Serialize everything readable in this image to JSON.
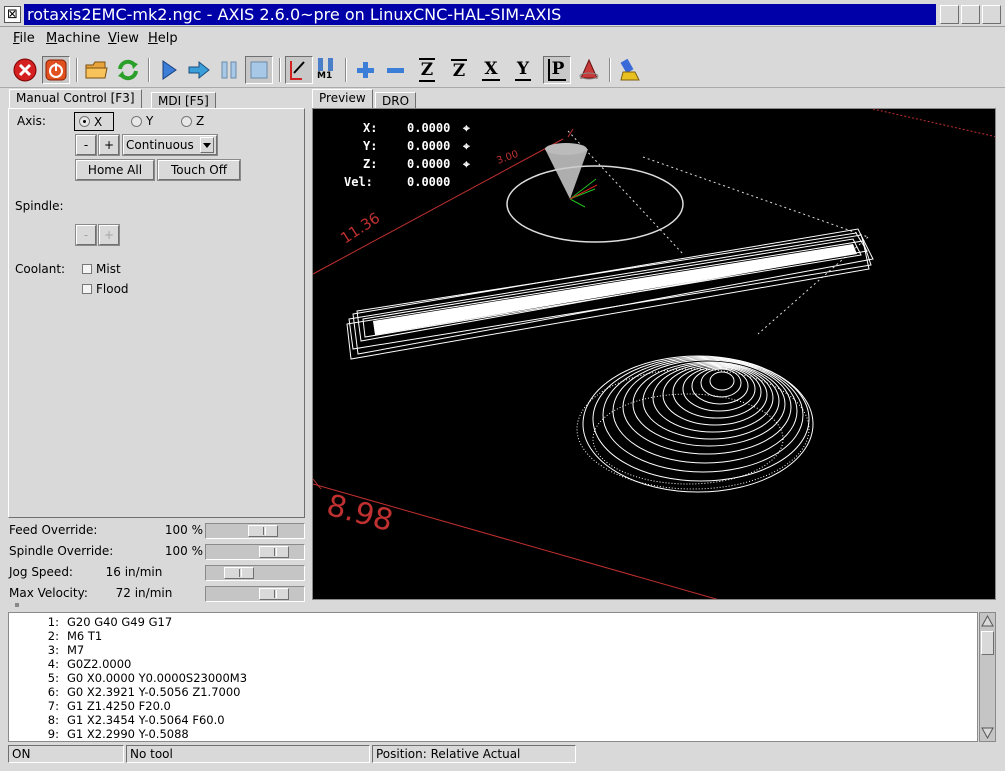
{
  "window": {
    "title": "rotaxis2EMC-mk2.ngc - AXIS 2.6.0~pre on LinuxCNC-HAL-SIM-AXIS"
  },
  "menu": [
    {
      "label": "File",
      "underline": "F",
      "rest": "ile"
    },
    {
      "label": "Machine",
      "underline": "M",
      "rest": "achine"
    },
    {
      "label": "View",
      "underline": "V",
      "rest": "iew"
    },
    {
      "label": "Help",
      "underline": "H",
      "rest": "elp"
    }
  ],
  "toolbar": {
    "icons": [
      "estop-icon",
      "machine-power-icon",
      "open-file-icon",
      "reload-icon",
      "run-icon",
      "step-icon",
      "pause-icon",
      "stop-icon",
      "block-delete-icon",
      "optional-stop-icon",
      "zoom-in-icon",
      "zoom-out-icon",
      "view-z-icon",
      "view-z2-icon",
      "view-x-icon",
      "view-y-icon",
      "view-p-icon",
      "rotate-view-icon",
      "clear-backplot-icon"
    ],
    "optional_stop_label": "M1",
    "view_letters": {
      "z": "Z",
      "z2": "Z",
      "x": "X",
      "y": "Y",
      "p": "P"
    }
  },
  "tabs": {
    "left": [
      {
        "label": "Manual Control [F3]"
      },
      {
        "label": "MDI [F5]"
      }
    ],
    "right": [
      {
        "label": "Preview"
      },
      {
        "label": "DRO"
      }
    ]
  },
  "manual": {
    "axis_label": "Axis:",
    "axes": [
      {
        "label": "X",
        "selected": true
      },
      {
        "label": "Y",
        "selected": false
      },
      {
        "label": "Z",
        "selected": false
      }
    ],
    "jog_minus": "-",
    "jog_plus": "+",
    "jog_mode": "Continuous",
    "home_all": "Home All",
    "touch_off": "Touch Off",
    "spindle_label": "Spindle:",
    "spindle_minus": "-",
    "spindle_plus": "+",
    "coolant_label": "Coolant:",
    "mist": "Mist",
    "flood": "Flood"
  },
  "overrides": [
    {
      "name": "Feed Override:",
      "value": "100 %",
      "level": 0.62
    },
    {
      "name": "Spindle Override:",
      "value": "100 %",
      "level": 0.78
    },
    {
      "name": "Jog Speed:",
      "value": "16 in/min",
      "level": 0.26
    },
    {
      "name": "Max Velocity:",
      "value": "72 in/min",
      "level": 0.78
    }
  ],
  "dro": [
    {
      "axis": "X:",
      "value": "0.0000"
    },
    {
      "axis": "Y:",
      "value": "0.0000"
    },
    {
      "axis": "Z:",
      "value": "0.0000"
    },
    {
      "axis": "Vel:",
      "value": "0.0000"
    }
  ],
  "preview": {
    "dim_1": "11.36",
    "dim_2": "8.98",
    "dim_3": "3.00"
  },
  "gcode": [
    {
      "n": "1:",
      "text": "G20 G40 G49 G17"
    },
    {
      "n": "2:",
      "text": "M6 T1"
    },
    {
      "n": "3:",
      "text": "M7"
    },
    {
      "n": "4:",
      "text": "G0Z2.0000"
    },
    {
      "n": "5:",
      "text": "G0 X0.0000 Y0.0000S23000M3"
    },
    {
      "n": "6:",
      "text": "G0 X2.3921 Y-0.5056 Z1.7000"
    },
    {
      "n": "7:",
      "text": "G1 Z1.4250 F20.0"
    },
    {
      "n": "8:",
      "text": "G1 X2.3454 Y-0.5064 F60.0"
    },
    {
      "n": "9:",
      "text": "G1 X2.2990 Y-0.5088"
    }
  ],
  "status": {
    "state": "ON",
    "tool": "No tool",
    "position": "Position: Relative Actual"
  }
}
